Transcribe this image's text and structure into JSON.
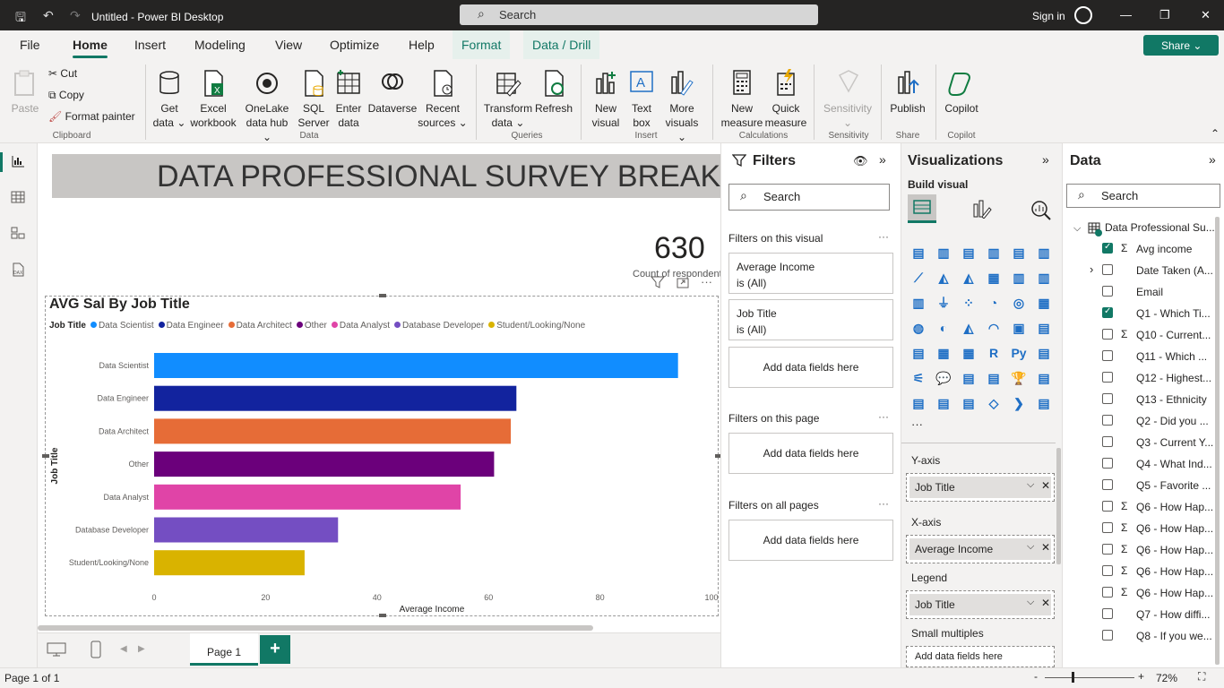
{
  "window": {
    "title": "Untitled - Power BI Desktop",
    "search_placeholder": "Search",
    "sign_in": "Sign in"
  },
  "menu": {
    "tabs": [
      "File",
      "Home",
      "Insert",
      "Modeling",
      "View",
      "Optimize",
      "Help",
      "Format",
      "Data / Drill"
    ],
    "active": "Home",
    "share_label": "Share"
  },
  "ribbon": {
    "clipboard": {
      "paste": "Paste",
      "cut": "Cut",
      "copy": "Copy",
      "format_painter": "Format painter",
      "group": "Clipboard"
    },
    "data": {
      "get_data": [
        "Get",
        "data ⌄"
      ],
      "excel": [
        "Excel",
        "workbook"
      ],
      "onelake": [
        "OneLake",
        "data hub ⌄"
      ],
      "sql": [
        "SQL",
        "Server"
      ],
      "enter": [
        "Enter",
        "data"
      ],
      "dataverse": [
        "Dataverse",
        ""
      ],
      "recent": [
        "Recent",
        "sources ⌄"
      ],
      "group": "Data"
    },
    "queries": {
      "transform": [
        "Transform",
        "data ⌄"
      ],
      "refresh": [
        "Refresh",
        ""
      ],
      "group": "Queries"
    },
    "insert": {
      "new_visual": [
        "New",
        "visual"
      ],
      "text_box": [
        "Text",
        "box"
      ],
      "more_visuals": [
        "More",
        "visuals ⌄"
      ],
      "group": "Insert"
    },
    "calculations": {
      "new_measure": [
        "New",
        "measure"
      ],
      "quick_measure": [
        "Quick",
        "measure"
      ],
      "group": "Calculations"
    },
    "sensitivity": {
      "label": [
        "Sensitivity",
        "⌄"
      ],
      "group": "Sensitivity"
    },
    "share": {
      "publish": [
        "Publish",
        ""
      ],
      "group": "Share"
    },
    "copilot": {
      "copilot": [
        "Copilot",
        ""
      ],
      "group": "Copilot"
    }
  },
  "report": {
    "title": "DATA PROFESSIONAL SURVEY BREAKDOWN",
    "kpi_value": "630",
    "kpi_label": "Count of respondents"
  },
  "chart_data": {
    "type": "bar",
    "title": "AVG Sal By Job Title",
    "legend_title": "Job Title",
    "categories": [
      "Data Scientist",
      "Data Engineer",
      "Data Architect",
      "Other",
      "Data Analyst",
      "Database Developer",
      "Student/Looking/None"
    ],
    "values": [
      94,
      65,
      64,
      61,
      55,
      33,
      27
    ],
    "colors": [
      "#118dff",
      "#12239e",
      "#e66c37",
      "#6b007b",
      "#e044a7",
      "#744ec2",
      "#d9b300"
    ],
    "xlabel": "Average Income",
    "ylabel": "Job Title",
    "xlim": [
      0,
      100
    ],
    "xticks": [
      "0",
      "20",
      "40",
      "60",
      "80",
      "100"
    ],
    "grid": false,
    "legend_position": "top-left"
  },
  "filters": {
    "title": "Filters",
    "search": "Search",
    "on_visual": "Filters on this visual",
    "cards": [
      {
        "name": "Average Income",
        "state": "is (All)"
      },
      {
        "name": "Job Title",
        "state": "is (All)"
      }
    ],
    "add_here": "Add data fields here",
    "on_page": "Filters on this page",
    "on_all": "Filters on all pages"
  },
  "visualizations": {
    "title": "Visualizations",
    "build": "Build visual",
    "wells": [
      {
        "label": "Y-axis",
        "value": "Job Title"
      },
      {
        "label": "X-axis",
        "value": "Average Income"
      },
      {
        "label": "Legend",
        "value": "Job Title"
      }
    ],
    "small_multiples": "Small multiples",
    "small_multiples_placeholder": "Add data fields here"
  },
  "data_pane": {
    "title": "Data",
    "search": "Search",
    "table": "Data Professional Su...",
    "fields": [
      {
        "name": "Avg income",
        "checked": true,
        "sigma": true
      },
      {
        "name": "Date Taken (A...",
        "checked": false,
        "sigma": false
      },
      {
        "name": "Email",
        "checked": false,
        "sigma": false
      },
      {
        "name": "Q1 - Which Ti...",
        "checked": true,
        "sigma": false
      },
      {
        "name": "Q10 - Current...",
        "checked": false,
        "sigma": true
      },
      {
        "name": "Q11 - Which ...",
        "checked": false,
        "sigma": false
      },
      {
        "name": "Q12 - Highest...",
        "checked": false,
        "sigma": false
      },
      {
        "name": "Q13 - Ethnicity",
        "checked": false,
        "sigma": false
      },
      {
        "name": "Q2 - Did you ...",
        "checked": false,
        "sigma": false
      },
      {
        "name": "Q3 - Current Y...",
        "checked": false,
        "sigma": false
      },
      {
        "name": "Q4 - What Ind...",
        "checked": false,
        "sigma": false
      },
      {
        "name": "Q5 - Favorite ...",
        "checked": false,
        "sigma": false
      },
      {
        "name": "Q6 - How Hap...",
        "checked": false,
        "sigma": true
      },
      {
        "name": "Q6 - How Hap...",
        "checked": false,
        "sigma": true
      },
      {
        "name": "Q6 - How Hap...",
        "checked": false,
        "sigma": true
      },
      {
        "name": "Q6 - How Hap...",
        "checked": false,
        "sigma": true
      },
      {
        "name": "Q6 - How Hap...",
        "checked": false,
        "sigma": true
      },
      {
        "name": "Q7 - How diffi...",
        "checked": false,
        "sigma": false
      },
      {
        "name": "Q8 - If you we...",
        "checked": false,
        "sigma": false
      }
    ]
  },
  "pages": {
    "tab": "Page 1",
    "add": "+"
  },
  "status": {
    "page": "Page 1 of 1",
    "zoom": "72%"
  }
}
